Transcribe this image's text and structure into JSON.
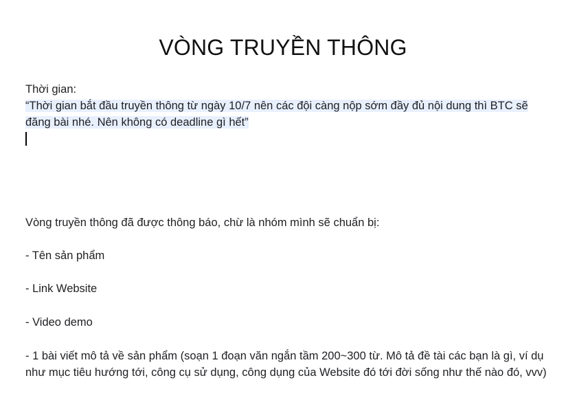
{
  "document": {
    "title": "VÒNG TRUYỀN THÔNG",
    "time_label": "Thời gian:",
    "time_quote": "“Thời gian bắt đầu truyền thông từ ngày 10/7 nên các đội càng nộp sớm đầy đủ nội dung thì BTC sẽ đăng bài nhé. Nên không có deadline gì hết”",
    "intro": "Vòng truyền thông đã được thông báo, chừ là nhóm mình sẽ chuẩn bị:",
    "items": [
      "- Tên sản phẩm",
      "- Link Website",
      "- Video demo",
      "- 1 bài viết mô tả về sản phẩm (soạn 1 đoạn văn ngắn tầm 200~300 từ. Mô tả đề tài các bạn là gì, ví dụ như mục tiêu hướng tới, công cụ sử dụng, công dụng của Website đó tới đời sống như thế nào đó, vvv)"
    ]
  },
  "colors": {
    "selection_highlight": "#e8f0fe",
    "text": "#202124"
  }
}
